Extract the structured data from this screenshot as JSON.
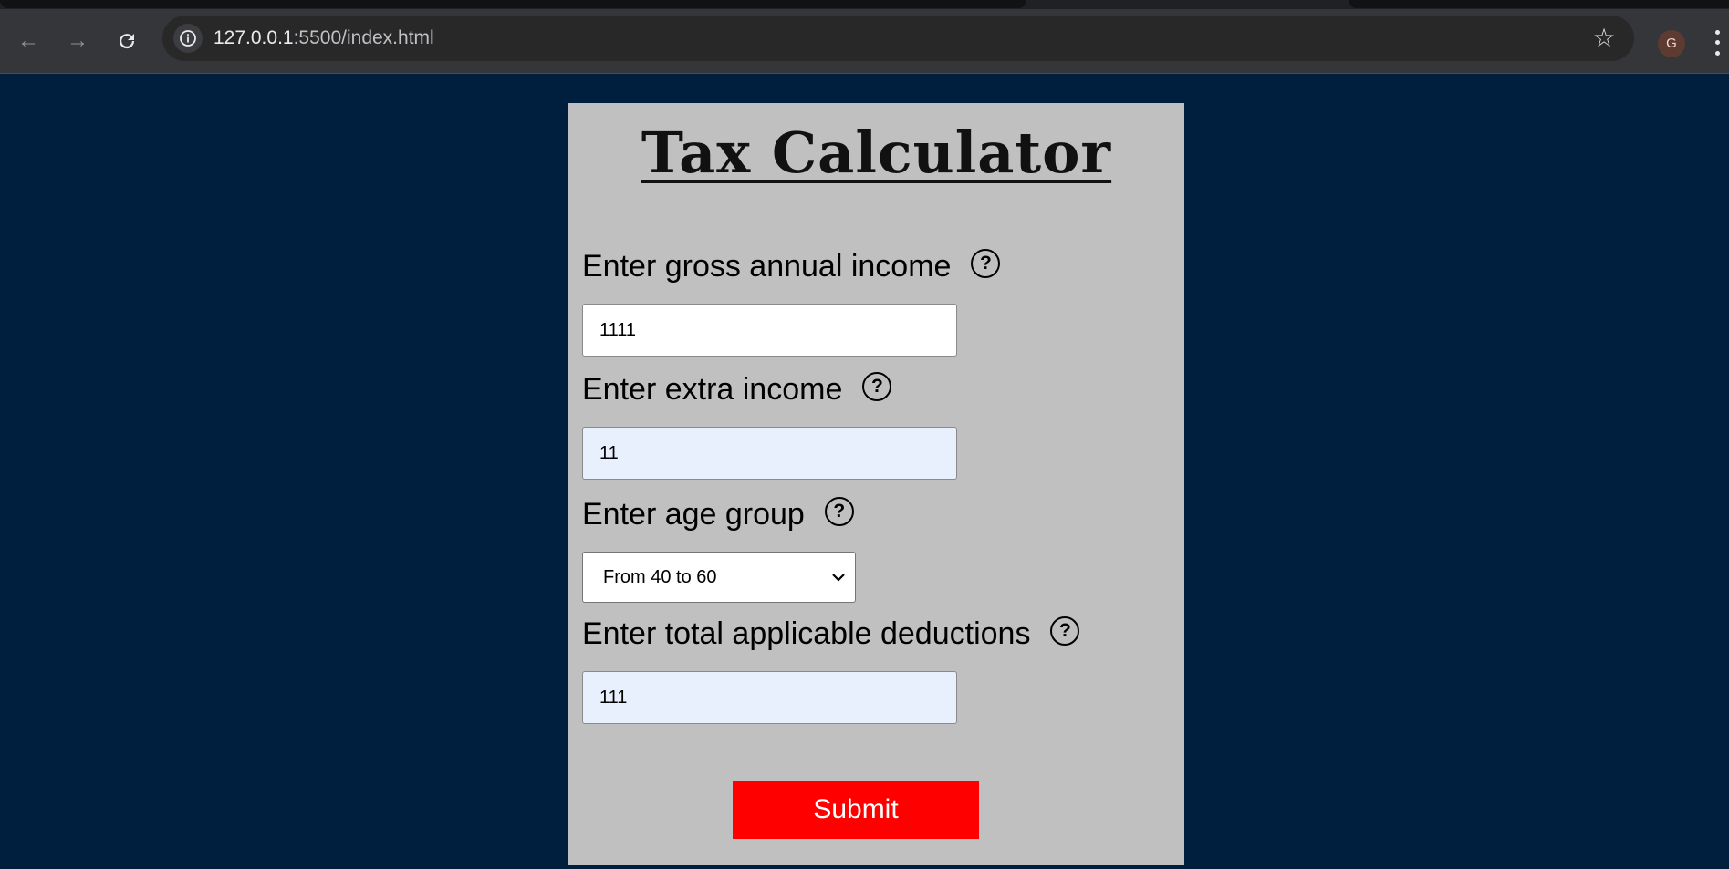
{
  "browser": {
    "url_host": "127.0.0.1",
    "url_rest": ":5500/index.html",
    "profile_initial": "G"
  },
  "page": {
    "title": "Tax Calculator",
    "gross_income": {
      "label": "Enter gross annual income",
      "value": "1111"
    },
    "extra_income": {
      "label": "Enter extra income",
      "value": "11"
    },
    "age_group": {
      "label": "Enter age group",
      "selected": "From 40 to 60"
    },
    "deductions": {
      "label": "Enter total applicable deductions",
      "value": "111"
    },
    "help_glyph": "?",
    "submit_label": "Submit"
  },
  "colors": {
    "page_background": "#001f3f",
    "card_background": "#c0c0c0",
    "submit_background": "#ff0000",
    "autofill_background": "#e8f0fe"
  }
}
